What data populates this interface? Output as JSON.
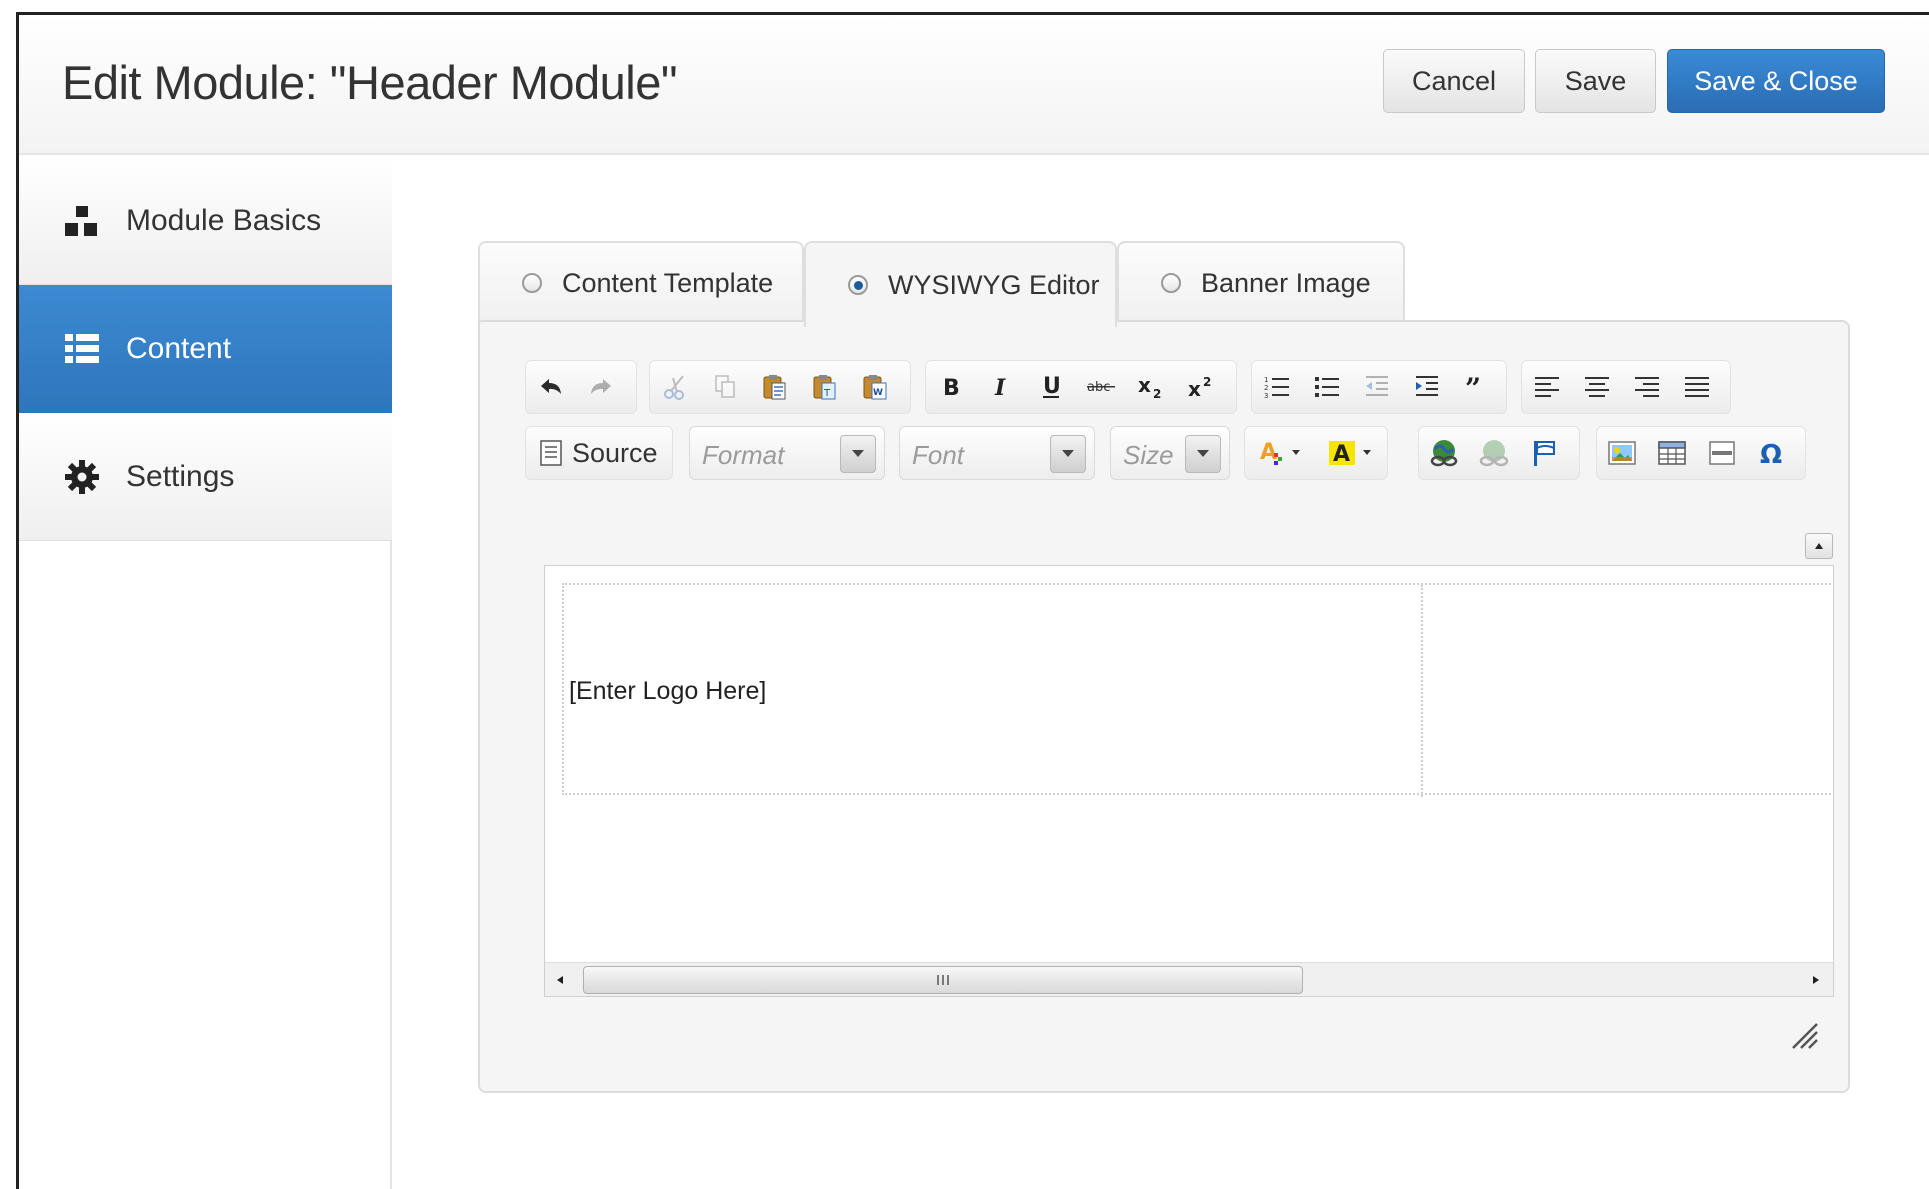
{
  "header": {
    "title": "Edit Module: \"Header Module\"",
    "cancel_label": "Cancel",
    "save_label": "Save",
    "save_close_label": "Save & Close"
  },
  "sidebar": {
    "items": [
      {
        "label": "Module Basics",
        "icon": "sitemap-icon",
        "active": false
      },
      {
        "label": "Content",
        "icon": "list-icon",
        "active": true
      },
      {
        "label": "Settings",
        "icon": "gear-icon",
        "active": false
      }
    ]
  },
  "tabs": [
    {
      "label": "Content Template",
      "selected": false
    },
    {
      "label": "WYSIWYG Editor",
      "selected": true
    },
    {
      "label": "Banner Image",
      "selected": false
    }
  ],
  "toolbar": {
    "source_label": "Source",
    "format_placeholder": "Format",
    "font_placeholder": "Font",
    "size_placeholder": "Size"
  },
  "editor": {
    "logo_placeholder": "[Enter Logo Here]"
  },
  "colors": {
    "primary": "#2e75bc",
    "sidebar_active": "#3581c8",
    "panel_bg": "#f5f5f5"
  }
}
